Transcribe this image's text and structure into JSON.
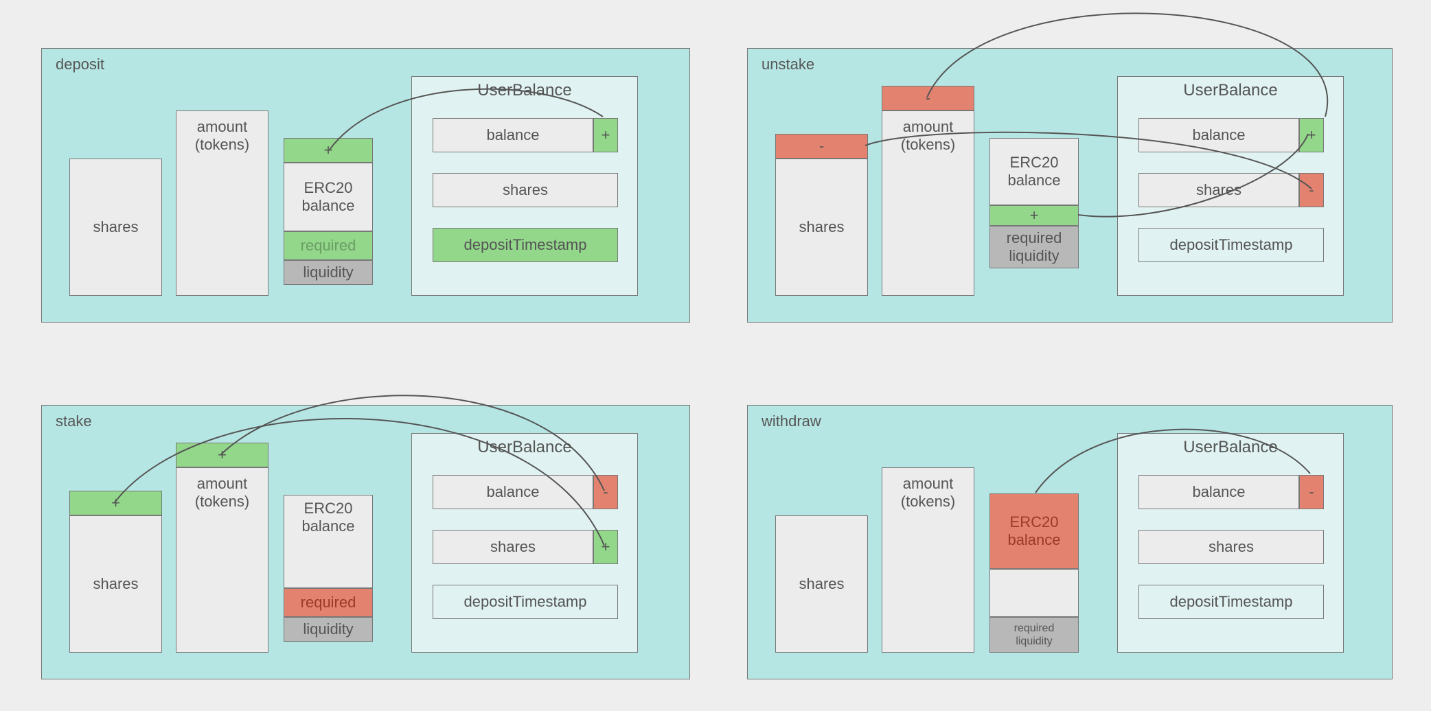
{
  "labels": {
    "deposit": "deposit",
    "stake": "stake",
    "unstake": "unstake",
    "withdraw": "withdraw",
    "shares": "shares",
    "amount_tokens": "amount\n(tokens)",
    "erc20_balance": "ERC20\nbalance",
    "required": "required",
    "liquidity": "liquidity",
    "required_liquidity": "required\nliquidity",
    "user_balance": "UserBalance",
    "balance": "balance",
    "depositTimestamp": "depositTimestamp",
    "plus": "+",
    "minus": "-"
  }
}
